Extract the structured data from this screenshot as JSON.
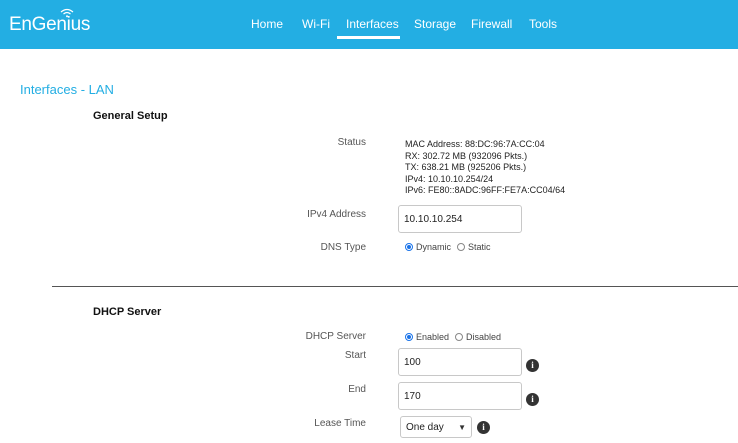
{
  "brand": {
    "logo_text": "EnGenius"
  },
  "nav": {
    "items": [
      {
        "label": "Home"
      },
      {
        "label": "Wi-Fi"
      },
      {
        "label": "Interfaces"
      },
      {
        "label": "Storage"
      },
      {
        "label": "Firewall"
      },
      {
        "label": "Tools"
      }
    ],
    "active": "Interfaces"
  },
  "page": {
    "title": "Interfaces - LAN"
  },
  "general_setup": {
    "title": "General Setup",
    "status": {
      "label": "Status",
      "mac_key": "MAC Address:",
      "mac_val": "88:DC:96:7A:CC:04",
      "rx_key": "RX:",
      "rx_val": "302.72 MB (932096 Pkts.)",
      "tx_key": "TX:",
      "tx_val": "638.21 MB (925206 Pkts.)",
      "ipv4_key": "IPv4:",
      "ipv4_val": "10.10.10.254/24",
      "ipv6_key": "IPv6:",
      "ipv6_val": "FE80::8ADC:96FF:FE7A:CC04/64"
    },
    "ipv4_address": {
      "label": "IPv4 Address",
      "value": "10.10.10.254"
    },
    "dns_type": {
      "label": "DNS Type",
      "options": [
        "Dynamic",
        "Static"
      ],
      "selected": "Dynamic"
    }
  },
  "dhcp_server": {
    "title": "DHCP Server",
    "enabled": {
      "label": "DHCP Server",
      "options": [
        "Enabled",
        "Disabled"
      ],
      "selected": "Enabled"
    },
    "start": {
      "label": "Start",
      "value": "100"
    },
    "end": {
      "label": "End",
      "value": "170"
    },
    "lease_time": {
      "label": "Lease Time",
      "value": "One day"
    }
  },
  "colors": {
    "accent": "#23aee3",
    "radio_selected": "#1a73e8"
  }
}
